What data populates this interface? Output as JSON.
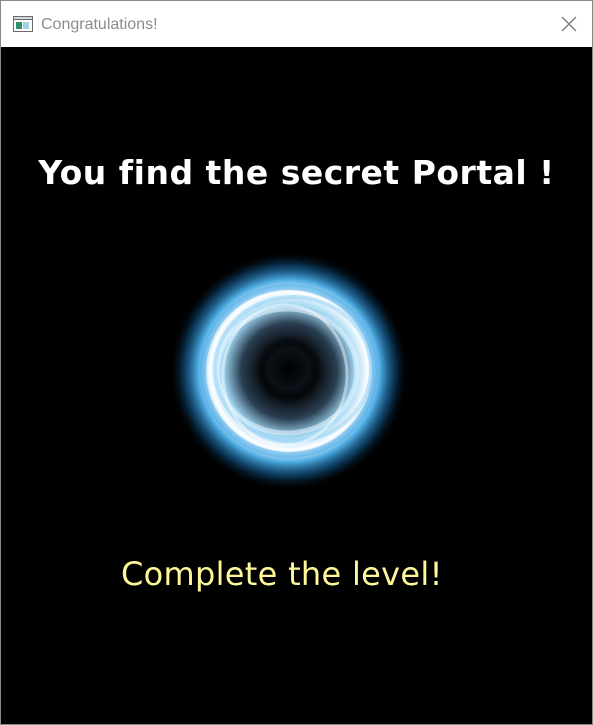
{
  "window": {
    "title": "Congratulations!",
    "app_icon": "window-app-icon",
    "close_icon": "close-icon"
  },
  "scene": {
    "headline": "You find the secret Portal !",
    "subline": "Complete the level!",
    "portal_icon": "portal-graphic",
    "colors": {
      "background": "#000000",
      "headline": "#ffffff",
      "subline": "#fff899",
      "portal_glow": "#3aa7e6"
    }
  }
}
